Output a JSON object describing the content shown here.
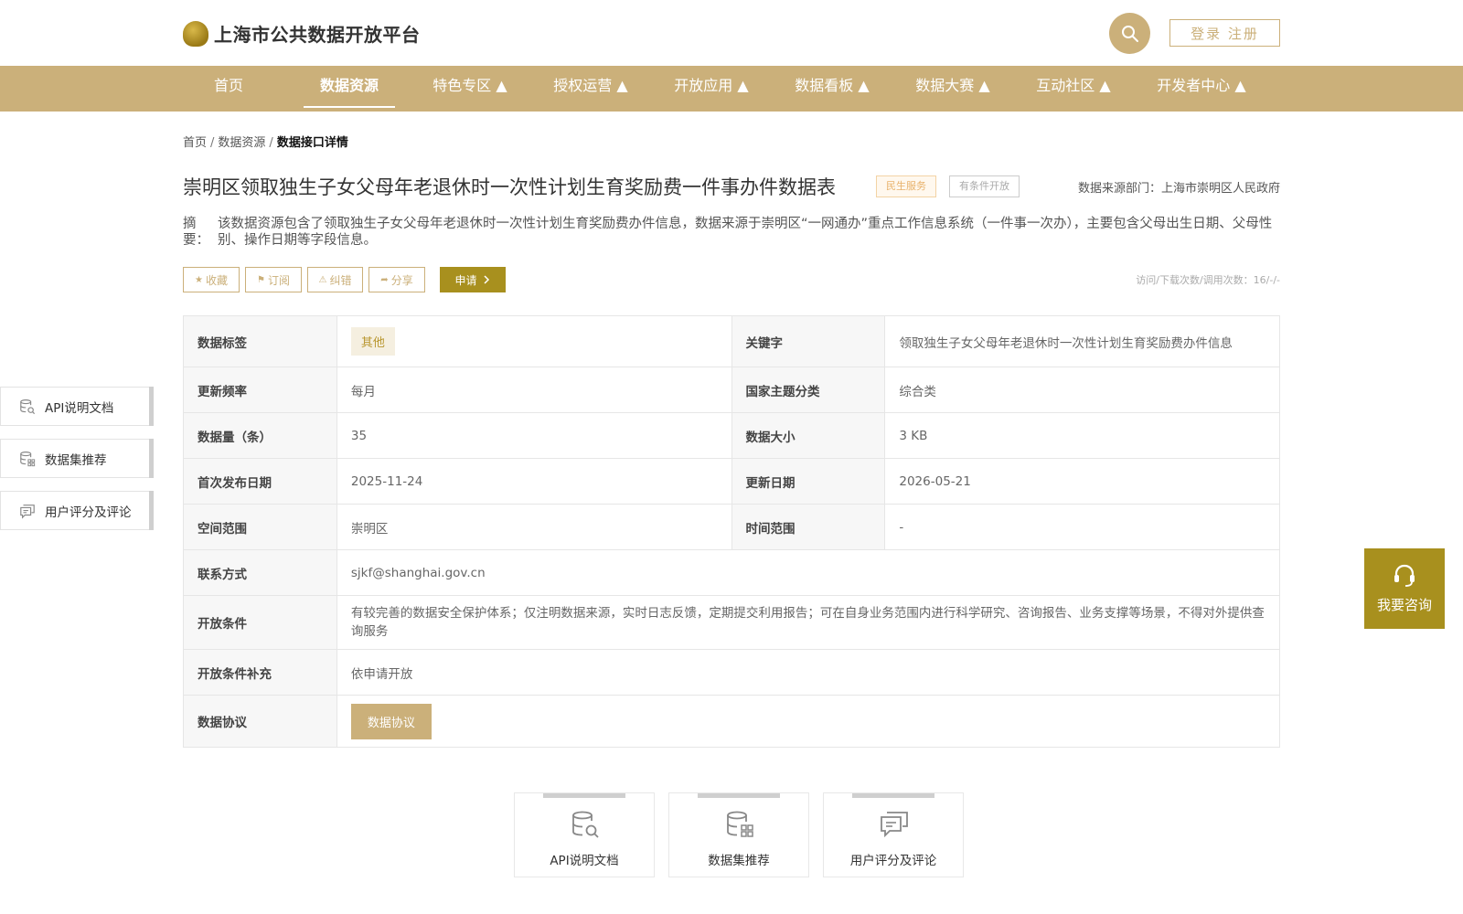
{
  "header": {
    "logo_text": "上海市公共数据开放平台",
    "login_label": "登录 注册"
  },
  "nav": {
    "items": [
      "首页",
      "数据资源",
      "特色专区 ▲",
      "授权运营 ▲",
      "开放应用 ▲",
      "数据看板 ▲",
      "数据大赛 ▲",
      "互动社区 ▲",
      "开发者中心 ▲"
    ],
    "active": "数据资源"
  },
  "breadcrumb": {
    "home": "首页",
    "section": "数据资源",
    "current": "数据接口详情"
  },
  "dataset": {
    "title": "崇明区领取独生子女父母年老退休时一次性计划生育奖励费一件事办件数据表",
    "tag_service": "民生服务",
    "tag_condition": "有条件开放",
    "source": "数据来源部门：上海市崇明区人民政府",
    "abstract_label": "摘 要：",
    "abstract": "该数据资源包含了领取独生子女父母年老退休时一次性计划生育奖励费办件信息，数据来源于崇明区“一网通办”重点工作信息系统（一件事一次办），主要包含父母出生日期、父母性别、操作日期等字段信息。"
  },
  "actions": {
    "collect": "收藏",
    "subscribe": "订阅",
    "correct": "纠错",
    "share": "分享",
    "apply": "申请",
    "counts": "访问/下载次数/调用次数：16/-/-"
  },
  "table": {
    "tags_label": "数据标签",
    "tags_value": "其他",
    "keywords_label": "关键字",
    "keywords_value": "领取独生子女父母年老退休时一次性计划生育奖励费办件信息",
    "freq_label": "更新频率",
    "freq_value": "每月",
    "theme_label": "国家主题分类",
    "theme_value": "综合类",
    "count_label": "数据量（条）",
    "count_value": "35",
    "size_label": "数据大小",
    "size_value": "3 KB",
    "first_pub_label": "首次发布日期",
    "first_pub_value": "2025-11-24",
    "update_label": "更新日期",
    "update_value": "2026-05-21",
    "space_label": "空间范围",
    "space_value": "崇明区",
    "time_label": "时间范围",
    "time_value": "-",
    "contact_label": "联系方式",
    "contact_value": "sjkf@shanghai.gov.cn",
    "open_cond_label": "开放条件",
    "open_cond_value": "有较完善的数据安全保护体系；仅注明数据来源，实时日志反馈，定期提交利用报告；可在自身业务范围内进行科学研究、咨询报告、业务支撑等场景，不得对外提供查询服务",
    "open_cond_sup_label": "开放条件补充",
    "open_cond_sup_value": "依申请开放",
    "protocol_label": "数据协议",
    "protocol_button": "数据协议"
  },
  "side": {
    "api_doc": "API说明文档",
    "dataset_rec": "数据集推荐",
    "rating": "用户评分及评论"
  },
  "consult": {
    "label": "我要咨询"
  },
  "bottom_cards": {
    "api_doc": "API说明文档",
    "dataset_rec": "数据集推荐",
    "rating": "用户评分及评论"
  },
  "colors": {
    "brand": "#cbb07a",
    "accent_dark": "#a8901e"
  }
}
